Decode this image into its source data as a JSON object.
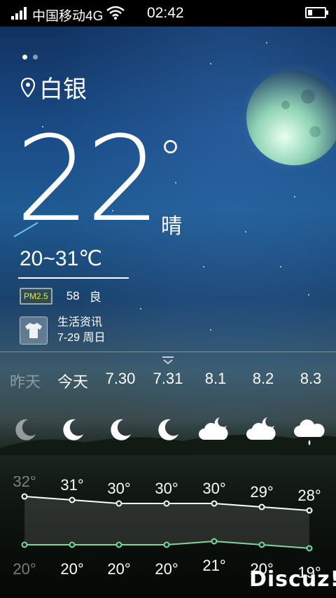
{
  "status_bar": {
    "carrier": "中国移动4G",
    "time": "02:42"
  },
  "location": {
    "city": "白银"
  },
  "current": {
    "temperature": "22",
    "degree_symbol": "°",
    "condition": "晴",
    "range": "20~31℃"
  },
  "air": {
    "badge": "PM2.5",
    "value": "58",
    "quality": "良"
  },
  "life_info": {
    "title": "生活资讯",
    "date": "7-29 周日"
  },
  "forecast": {
    "days": [
      {
        "label": "昨天",
        "icon": "moon-icon",
        "high": "32°",
        "low": "20°",
        "dimmed": true
      },
      {
        "label": "今天",
        "icon": "moon-icon",
        "high": "31°",
        "low": "20°",
        "dimmed": false
      },
      {
        "label": "7.30",
        "icon": "moon-icon",
        "high": "30°",
        "low": "20°",
        "dimmed": false
      },
      {
        "label": "7.31",
        "icon": "moon-icon",
        "high": "30°",
        "low": "20°",
        "dimmed": false
      },
      {
        "label": "8.1",
        "icon": "partly-cloudy-night-icon",
        "high": "30°",
        "low": "21°",
        "dimmed": false
      },
      {
        "label": "8.2",
        "icon": "partly-cloudy-night-icon",
        "high": "29°",
        "low": "20°",
        "dimmed": false
      },
      {
        "label": "8.3",
        "icon": "rain-cloud-icon",
        "high": "28°",
        "low": "19°",
        "dimmed": false
      }
    ],
    "high_values": [
      32,
      31,
      30,
      30,
      30,
      29,
      28
    ],
    "low_values": [
      20,
      20,
      20,
      20,
      21,
      20,
      19
    ]
  },
  "colors": {
    "high_line": "#ffffff",
    "low_line": "#7fd6a0"
  },
  "watermark": "Discuz!"
}
